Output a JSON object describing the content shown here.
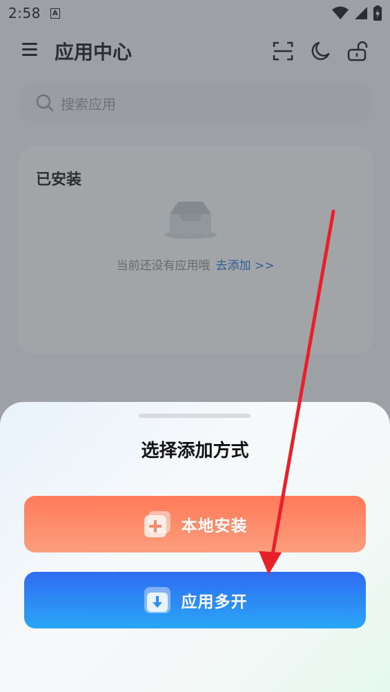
{
  "status_bar": {
    "time": "2:58",
    "notif_letter": "A"
  },
  "header": {
    "title": "应用中心"
  },
  "search": {
    "placeholder": "搜索应用"
  },
  "installed": {
    "title": "已安装",
    "empty_text": "当前还没有应用哦",
    "add_link": "去添加 >>"
  },
  "sheet": {
    "title": "选择添加方式",
    "options": [
      {
        "label": "本地安装",
        "icon": "plus-icon"
      },
      {
        "label": "应用多开",
        "icon": "download-icon"
      }
    ]
  },
  "colors": {
    "local_button": "#ff7a5a",
    "multi_button": "#2f6cf2",
    "link": "#1e6fd6",
    "annotation_arrow": "#e8202a"
  }
}
